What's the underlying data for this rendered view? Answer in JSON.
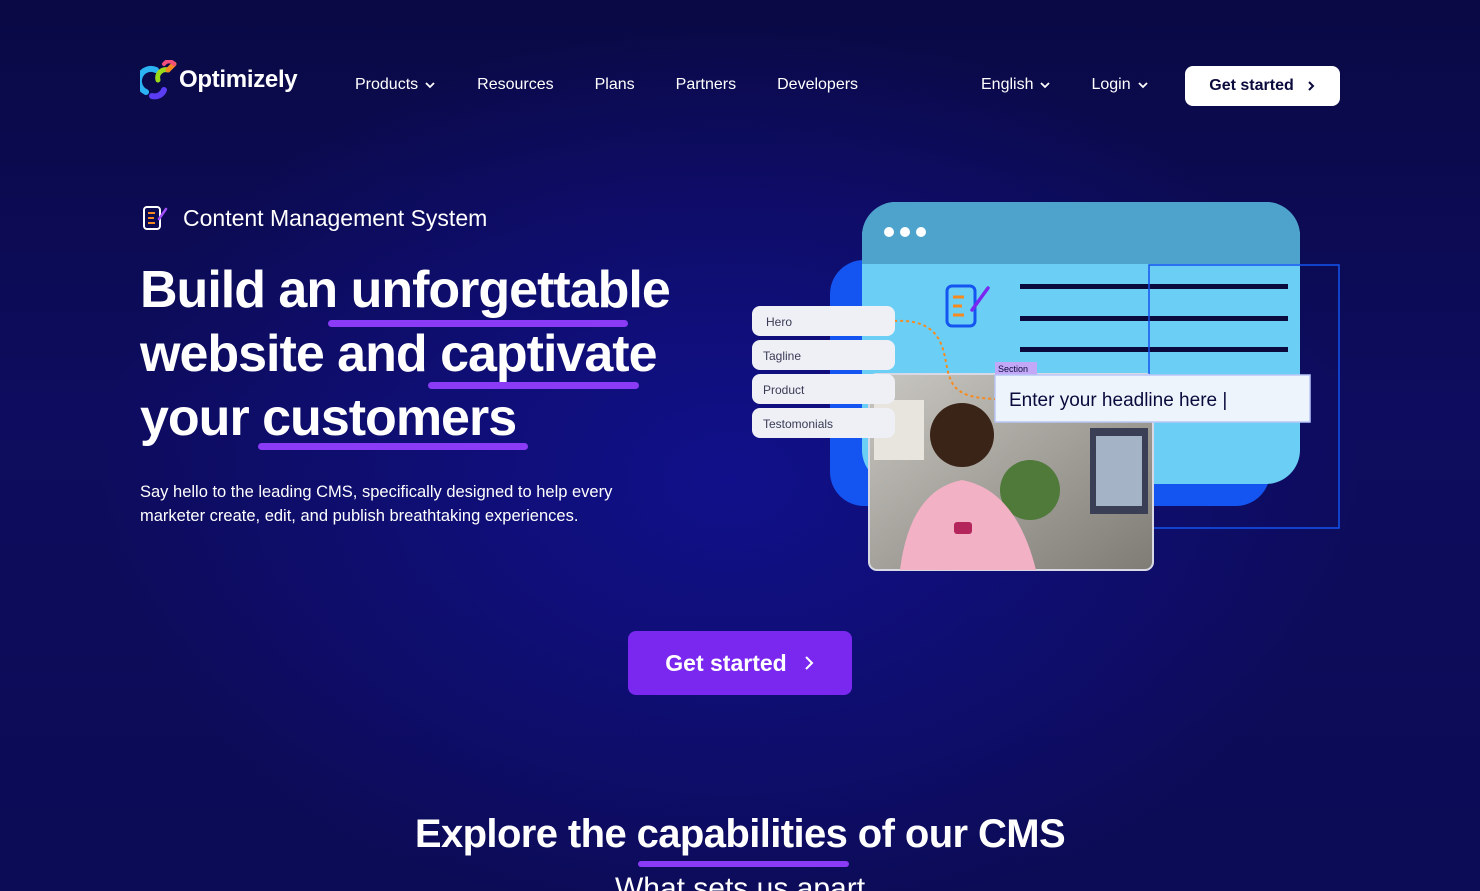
{
  "brand": {
    "name": "Optimizely"
  },
  "nav": {
    "items": [
      {
        "label": "Products",
        "dropdown": true
      },
      {
        "label": "Resources",
        "dropdown": false
      },
      {
        "label": "Plans",
        "dropdown": false
      },
      {
        "label": "Partners",
        "dropdown": false
      },
      {
        "label": "Developers",
        "dropdown": false
      }
    ],
    "language": "English",
    "login": "Login",
    "cta": "Get started"
  },
  "hero": {
    "eyebrow": "Content Management System",
    "headline": {
      "p1": "Build an ",
      "b1": "unforgettable",
      "p2": "website",
      "p3": " and ",
      "b2": "captivate",
      "p4": "your ",
      "b3": "customers"
    },
    "subcopy": "Say hello to the leading CMS, specifically designed to help every marketer create, edit, and publish breathtaking experiences.",
    "cta": "Get started"
  },
  "illustration": {
    "blocks": [
      "Hero",
      "Tagline",
      "Product",
      "Testomonials"
    ],
    "section_tag": "Section",
    "headline_placeholder": "Enter your headline here |"
  },
  "explore": {
    "prefix": "Explore the ",
    "bold": "capabilities",
    "suffix": " of our CMS",
    "sub": "What sets us apart"
  },
  "colors": {
    "background": "#0c0b55",
    "accent_purple": "#7a28f0",
    "underline": "#8b3bf6",
    "illustration_blue": "#6bcff5",
    "illustration_dark_blue": "#1454f0"
  }
}
